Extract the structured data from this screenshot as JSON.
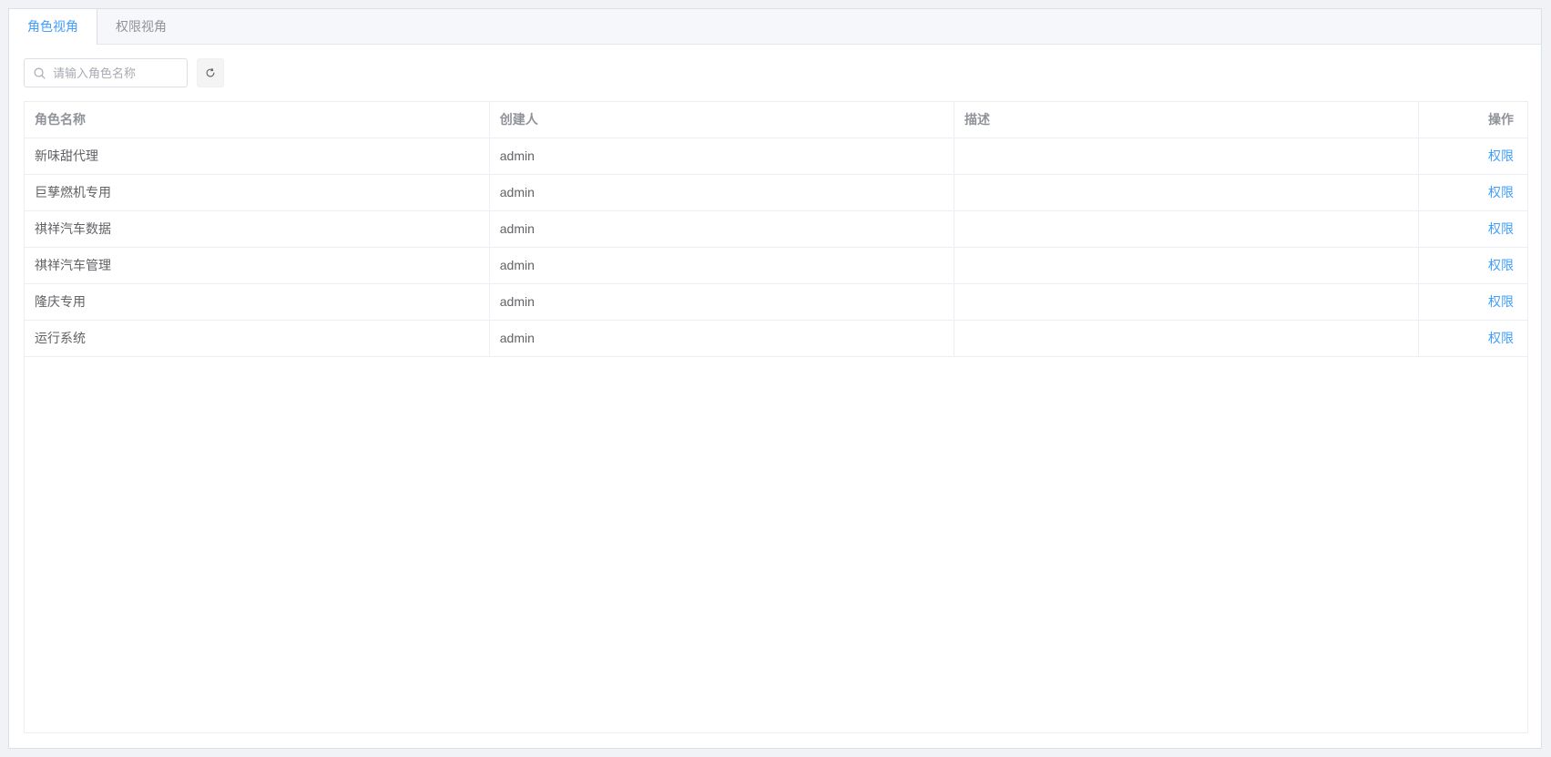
{
  "tabs": [
    {
      "label": "角色视角",
      "active": true
    },
    {
      "label": "权限视角",
      "active": false
    }
  ],
  "search": {
    "placeholder": "请输入角色名称",
    "value": ""
  },
  "table": {
    "columns": [
      "角色名称",
      "创建人",
      "描述",
      "操作"
    ],
    "rows": [
      {
        "name": "新味甜代理",
        "creator": "admin",
        "description": "",
        "action": "权限"
      },
      {
        "name": "巨孳燃机专用",
        "creator": "admin",
        "description": "",
        "action": "权限"
      },
      {
        "name": "祺祥汽车数据",
        "creator": "admin",
        "description": "",
        "action": "权限"
      },
      {
        "name": "祺祥汽车管理",
        "creator": "admin",
        "description": "",
        "action": "权限"
      },
      {
        "name": "隆庆专用",
        "creator": "admin",
        "description": "",
        "action": "权限"
      },
      {
        "name": "运行系统",
        "creator": "admin",
        "description": "",
        "action": "权限"
      }
    ]
  },
  "colors": {
    "accent": "#409eff",
    "border": "#ebeef5",
    "header_text": "#909399"
  },
  "icons": {
    "search": "search-icon",
    "refresh": "refresh-icon"
  }
}
